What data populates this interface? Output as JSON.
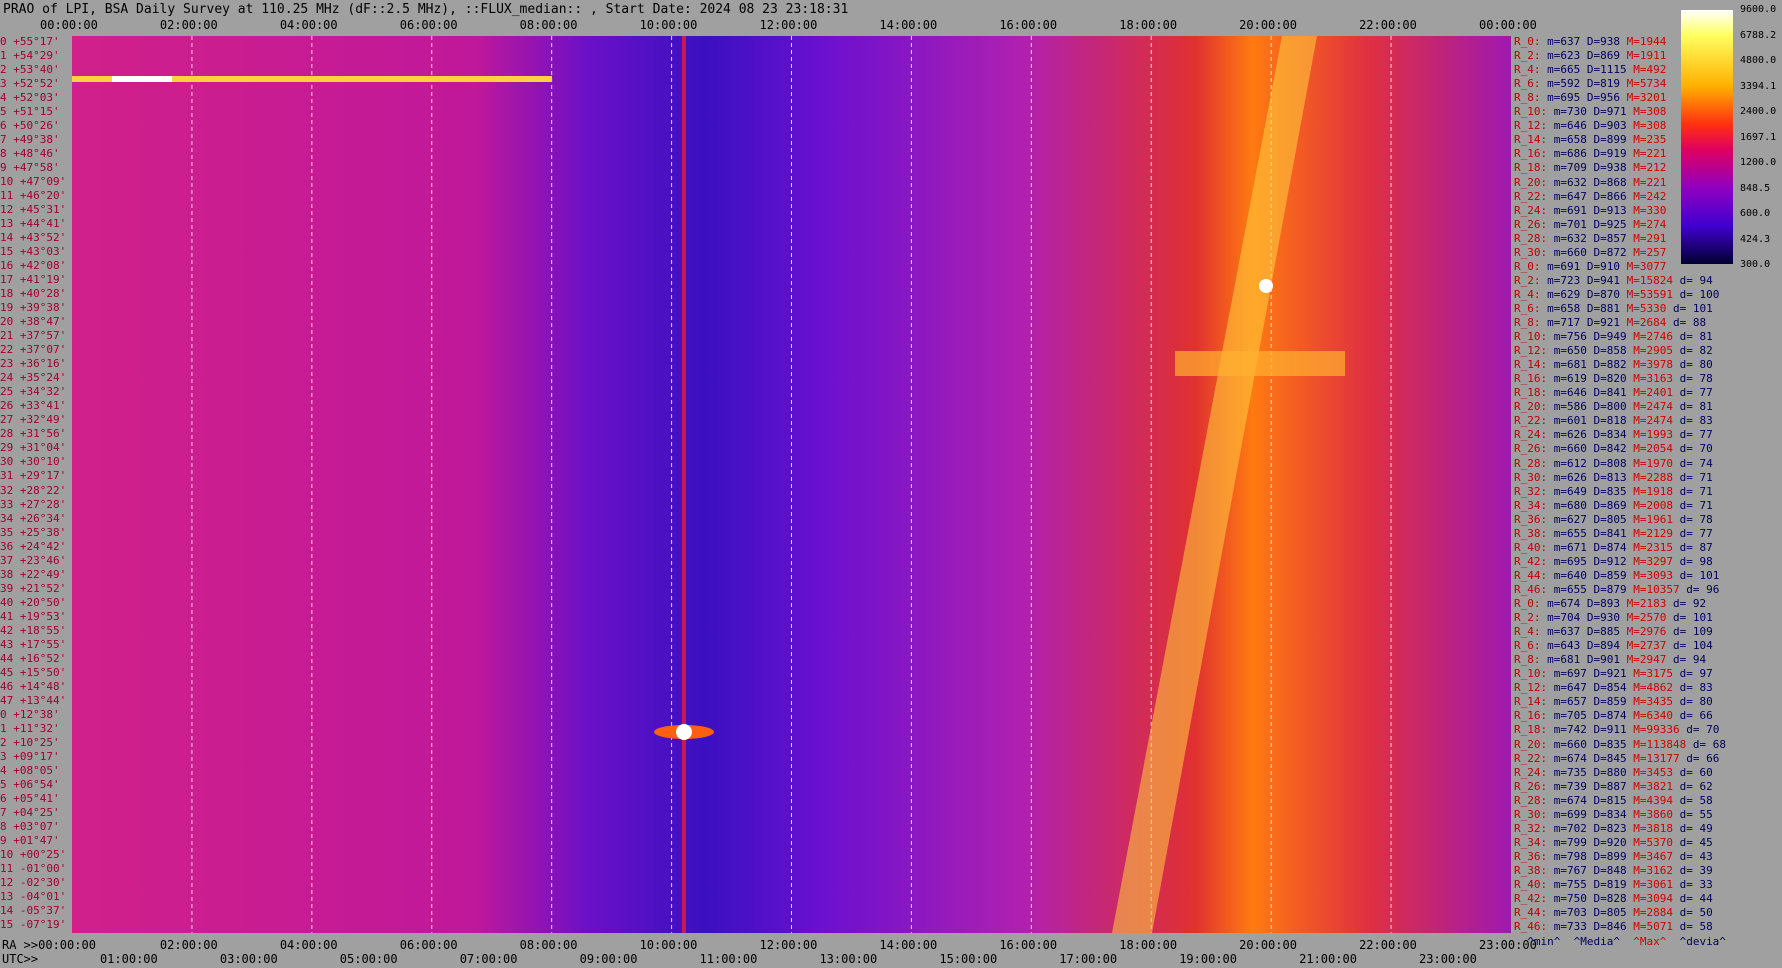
{
  "title": "PRAO of LPI, BSA Daily Survey at 110.25 MHz (dF::2.5 MHz), ::FLUX_median:: , Start Date: 2024 08 23 23:18:31",
  "chart_data": {
    "type": "heatmap",
    "top_ticks": [
      "00:00:00",
      "02:00:00",
      "04:00:00",
      "06:00:00",
      "08:00:00",
      "10:00:00",
      "12:00:00",
      "14:00:00",
      "16:00:00",
      "18:00:00",
      "20:00:00",
      "22:00:00",
      "00:00:00"
    ],
    "bottom_ra_ticks": [
      "RA >>00:00:00",
      "02:00:00",
      "04:00:00",
      "06:00:00",
      "08:00:00",
      "10:00:00",
      "12:00:00",
      "14:00:00",
      "16:00:00",
      "18:00:00",
      "20:00:00",
      "22:00:00",
      "23:00:00"
    ],
    "bottom_utc_ticks": [
      "UTC>>",
      "01:00:00",
      "03:00:00",
      "05:00:00",
      "07:00:00",
      "09:00:00",
      "11:00:00",
      "13:00:00",
      "15:00:00",
      "17:00:00",
      "19:00:00",
      "21:00:00",
      "23:00:00"
    ],
    "colorbar_ticks": [
      "9600.0",
      "6788.2",
      "4800.0",
      "3394.1",
      "2400.0",
      "1697.1",
      "1200.0",
      "848.5",
      "600.0",
      "424.3",
      "300.0"
    ],
    "declinations": [
      "+55°17'",
      "+54°29'",
      "+53°40'",
      "+52°52'",
      "+52°03'",
      "+51°15'",
      "+50°26'",
      "+49°38'",
      "+48°46'",
      "+47°58'",
      "+47°09'",
      "+46°20'",
      "+45°31'",
      "+44°41'",
      "+43°52'",
      "+43°03'",
      "+42°08'",
      "+41°19'",
      "+40°28'",
      "+39°38'",
      "+38°47'",
      "+37°57'",
      "+37°07'",
      "+36°16'",
      "+35°24'",
      "+34°32'",
      "+33°41'",
      "+32°49'",
      "+31°56'",
      "+31°04'",
      "+30°10'",
      "+29°17'",
      "+28°22'",
      "+27°28'",
      "+26°34'",
      "+25°38'",
      "+24°42'",
      "+23°46'",
      "+22°49'",
      "+21°52'",
      "+20°50'",
      "+19°53'",
      "+18°55'",
      "+17°55'",
      "+16°52'",
      "+15°50'",
      "+14°48'",
      "+13°44'",
      "+12°38'",
      "+11°32'",
      "+10°25'",
      "+09°17'",
      "+08°05'",
      "+06°54'",
      "+05°41'",
      "+04°25'",
      "+03°07'",
      "+01°47'",
      "+00°25'",
      "-01°00'",
      "-02°30'",
      "-04°01'",
      "-05°37'",
      "-07°19'"
    ],
    "legend_footer": [
      "^min^",
      "^Media^",
      "^Max^",
      "^devia^"
    ],
    "stats": [
      {
        "r": "R_0:",
        "m": "m=637",
        "d": "D=938",
        "M": "M=1944",
        "dv": ""
      },
      {
        "r": "R_2:",
        "m": "m=623",
        "d": "D=869",
        "M": "M=1911",
        "dv": ""
      },
      {
        "r": "R_4:",
        "m": "m=665",
        "d": "D=1115",
        "M": "M=492",
        "dv": ""
      },
      {
        "r": "R_6:",
        "m": "m=592",
        "d": "D=819",
        "M": "M=5734",
        "dv": ""
      },
      {
        "r": "R_8:",
        "m": "m=695",
        "d": "D=956",
        "M": "M=3201",
        "dv": ""
      },
      {
        "r": "R_10:",
        "m": "m=730",
        "d": "D=971",
        "M": "M=308",
        "dv": ""
      },
      {
        "r": "R_12:",
        "m": "m=646",
        "d": "D=903",
        "M": "M=308",
        "dv": ""
      },
      {
        "r": "R_14:",
        "m": "m=658",
        "d": "D=899",
        "M": "M=235",
        "dv": ""
      },
      {
        "r": "R_16:",
        "m": "m=686",
        "d": "D=919",
        "M": "M=221",
        "dv": ""
      },
      {
        "r": "R_18:",
        "m": "m=709",
        "d": "D=938",
        "M": "M=212",
        "dv": ""
      },
      {
        "r": "R_20:",
        "m": "m=632",
        "d": "D=868",
        "M": "M=221",
        "dv": ""
      },
      {
        "r": "R_22:",
        "m": "m=647",
        "d": "D=866",
        "M": "M=242",
        "dv": ""
      },
      {
        "r": "R_24:",
        "m": "m=691",
        "d": "D=913",
        "M": "M=330",
        "dv": ""
      },
      {
        "r": "R_26:",
        "m": "m=701",
        "d": "D=925",
        "M": "M=274",
        "dv": ""
      },
      {
        "r": "R_28:",
        "m": "m=632",
        "d": "D=857",
        "M": "M=291",
        "dv": ""
      },
      {
        "r": "R_30:",
        "m": "m=660",
        "d": "D=872",
        "M": "M=257",
        "dv": ""
      },
      {
        "r": "R_0:",
        "m": "m=691",
        "d": "D=910",
        "M": "M=3077",
        "dv": ""
      },
      {
        "r": "R_2:",
        "m": "m=723",
        "d": "D=941",
        "M": "M=15824",
        "dv": "d= 94"
      },
      {
        "r": "R_4:",
        "m": "m=629",
        "d": "D=870",
        "M": "M=53591",
        "dv": "d= 100"
      },
      {
        "r": "R_6:",
        "m": "m=658",
        "d": "D=881",
        "M": "M=5330",
        "dv": "d= 101"
      },
      {
        "r": "R_8:",
        "m": "m=717",
        "d": "D=921",
        "M": "M=2684",
        "dv": "d= 88"
      },
      {
        "r": "R_10:",
        "m": "m=756",
        "d": "D=949",
        "M": "M=2746",
        "dv": "d= 81"
      },
      {
        "r": "R_12:",
        "m": "m=650",
        "d": "D=858",
        "M": "M=2905",
        "dv": "d= 82"
      },
      {
        "r": "R_14:",
        "m": "m=681",
        "d": "D=882",
        "M": "M=3978",
        "dv": "d= 80"
      },
      {
        "r": "R_16:",
        "m": "m=619",
        "d": "D=820",
        "M": "M=3163",
        "dv": "d= 78"
      },
      {
        "r": "R_18:",
        "m": "m=646",
        "d": "D=841",
        "M": "M=2401",
        "dv": "d= 77"
      },
      {
        "r": "R_20:",
        "m": "m=586",
        "d": "D=800",
        "M": "M=2474",
        "dv": "d= 81"
      },
      {
        "r": "R_22:",
        "m": "m=601",
        "d": "D=818",
        "M": "M=2474",
        "dv": "d= 83"
      },
      {
        "r": "R_24:",
        "m": "m=626",
        "d": "D=834",
        "M": "M=1993",
        "dv": "d= 77"
      },
      {
        "r": "R_26:",
        "m": "m=660",
        "d": "D=842",
        "M": "M=2054",
        "dv": "d= 70"
      },
      {
        "r": "R_28:",
        "m": "m=612",
        "d": "D=808",
        "M": "M=1970",
        "dv": "d= 74"
      },
      {
        "r": "R_30:",
        "m": "m=626",
        "d": "D=813",
        "M": "M=2288",
        "dv": "d= 71"
      },
      {
        "r": "R_32:",
        "m": "m=649",
        "d": "D=835",
        "M": "M=1918",
        "dv": "d= 71"
      },
      {
        "r": "R_34:",
        "m": "m=680",
        "d": "D=869",
        "M": "M=2008",
        "dv": "d= 71"
      },
      {
        "r": "R_36:",
        "m": "m=627",
        "d": "D=805",
        "M": "M=1961",
        "dv": "d= 78"
      },
      {
        "r": "R_38:",
        "m": "m=655",
        "d": "D=841",
        "M": "M=2129",
        "dv": "d= 77"
      },
      {
        "r": "R_40:",
        "m": "m=671",
        "d": "D=874",
        "M": "M=2315",
        "dv": "d= 87"
      },
      {
        "r": "R_42:",
        "m": "m=695",
        "d": "D=912",
        "M": "M=3297",
        "dv": "d= 98"
      },
      {
        "r": "R_44:",
        "m": "m=640",
        "d": "D=859",
        "M": "M=3093",
        "dv": "d= 101"
      },
      {
        "r": "R_46:",
        "m": "m=655",
        "d": "D=879",
        "M": "M=10357",
        "dv": "d= 96"
      },
      {
        "r": "R_0:",
        "m": "m=674",
        "d": "D=893",
        "M": "M=2183",
        "dv": "d= 92"
      },
      {
        "r": "R_2:",
        "m": "m=704",
        "d": "D=930",
        "M": "M=2570",
        "dv": "d= 101"
      },
      {
        "r": "R_4:",
        "m": "m=637",
        "d": "D=885",
        "M": "M=2976",
        "dv": "d= 109"
      },
      {
        "r": "R_6:",
        "m": "m=643",
        "d": "D=894",
        "M": "M=2737",
        "dv": "d= 104"
      },
      {
        "r": "R_8:",
        "m": "m=681",
        "d": "D=901",
        "M": "M=2947",
        "dv": "d= 94"
      },
      {
        "r": "R_10:",
        "m": "m=697",
        "d": "D=921",
        "M": "M=3175",
        "dv": "d= 97"
      },
      {
        "r": "R_12:",
        "m": "m=647",
        "d": "D=854",
        "M": "M=4862",
        "dv": "d= 83"
      },
      {
        "r": "R_14:",
        "m": "m=657",
        "d": "D=859",
        "M": "M=3435",
        "dv": "d= 80"
      },
      {
        "r": "R_16:",
        "m": "m=705",
        "d": "D=874",
        "M": "M=6340",
        "dv": "d= 66"
      },
      {
        "r": "R_18:",
        "m": "m=742",
        "d": "D=911",
        "M": "M=99336",
        "dv": "d= 70"
      },
      {
        "r": "R_20:",
        "m": "m=660",
        "d": "D=835",
        "M": "M=113848",
        "dv": "d= 68"
      },
      {
        "r": "R_22:",
        "m": "m=674",
        "d": "D=845",
        "M": "M=13177",
        "dv": "d= 66"
      },
      {
        "r": "R_24:",
        "m": "m=735",
        "d": "D=880",
        "M": "M=3453",
        "dv": "d= 60"
      },
      {
        "r": "R_26:",
        "m": "m=739",
        "d": "D=887",
        "M": "M=3821",
        "dv": "d= 62"
      },
      {
        "r": "R_28:",
        "m": "m=674",
        "d": "D=815",
        "M": "M=4394",
        "dv": "d= 58"
      },
      {
        "r": "R_30:",
        "m": "m=699",
        "d": "D=834",
        "M": "M=3860",
        "dv": "d= 55"
      },
      {
        "r": "R_32:",
        "m": "m=702",
        "d": "D=823",
        "M": "M=3818",
        "dv": "d= 49"
      },
      {
        "r": "R_34:",
        "m": "m=799",
        "d": "D=920",
        "M": "M=5370",
        "dv": "d= 45"
      },
      {
        "r": "R_36:",
        "m": "m=798",
        "d": "D=899",
        "M": "M=3467",
        "dv": "d= 43"
      },
      {
        "r": "R_38:",
        "m": "m=767",
        "d": "D=848",
        "M": "M=3162",
        "dv": "d= 39"
      },
      {
        "r": "R_40:",
        "m": "m=755",
        "d": "D=819",
        "M": "M=3061",
        "dv": "d= 33"
      },
      {
        "r": "R_42:",
        "m": "m=750",
        "d": "D=828",
        "M": "M=3094",
        "dv": "d= 44"
      },
      {
        "r": "R_44:",
        "m": "m=703",
        "d": "D=805",
        "M": "M=2884",
        "dv": "d= 50"
      },
      {
        "r": "R_46:",
        "m": "m=733",
        "d": "D=846",
        "M": "M=5071",
        "dv": "d= 58"
      }
    ]
  }
}
